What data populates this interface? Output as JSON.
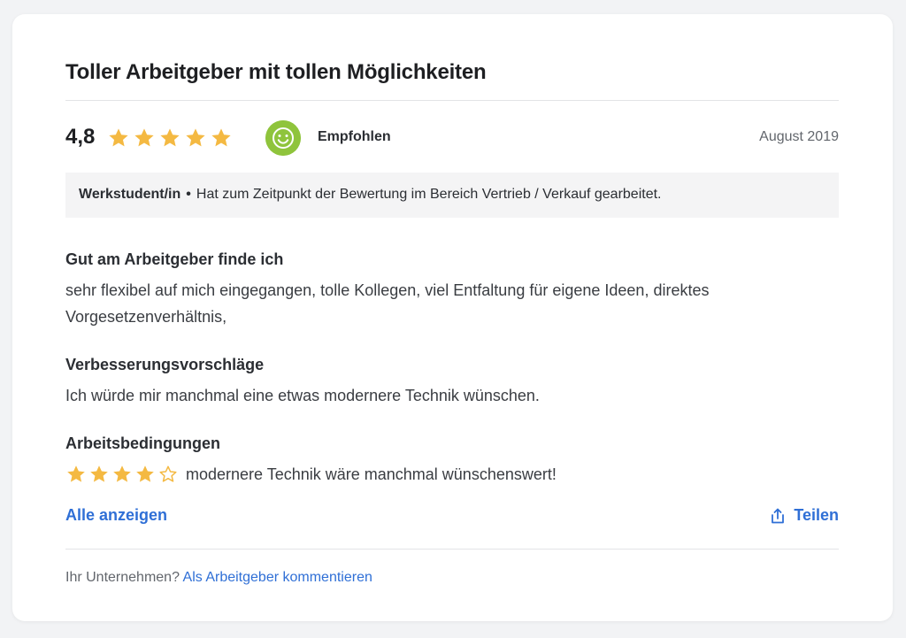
{
  "review": {
    "title": "Toller Arbeitgeber mit tollen Möglichkeiten",
    "score": "4,8",
    "overall_stars": 4.8,
    "recommendation": "Empfohlen",
    "date": "August 2019",
    "role": "Werkstudent/in",
    "separator": "•",
    "context": "Hat zum Zeitpunkt der Bewertung im Bereich Vertrieb / Verkauf gearbeitet."
  },
  "sections": [
    {
      "heading": "Gut am Arbeitgeber finde ich",
      "text": "sehr flexibel auf mich eingegangen, tolle Kollegen, viel Entfaltung für eigene Ideen, direktes Vorgesetzenverhältnis,"
    },
    {
      "heading": "Verbesserungsvorschläge",
      "text": "Ich würde mir manchmal eine etwas modernere Technik wünschen."
    },
    {
      "heading": "Arbeitsbedingungen",
      "stars": 4,
      "text": "modernere Technik wäre manchmal wünschenswert!"
    }
  ],
  "actions": {
    "show_all": "Alle anzeigen",
    "share": "Teilen"
  },
  "footer": {
    "question": "Ihr Unternehmen?",
    "link": "Als Arbeitgeber kommentieren"
  },
  "icons": {
    "star": "star-icon",
    "smiley": "smiley-icon",
    "share": "share-icon"
  },
  "colors": {
    "star": "#f4b942",
    "smiley": "#8fc43c",
    "link": "#2f6fd6"
  }
}
